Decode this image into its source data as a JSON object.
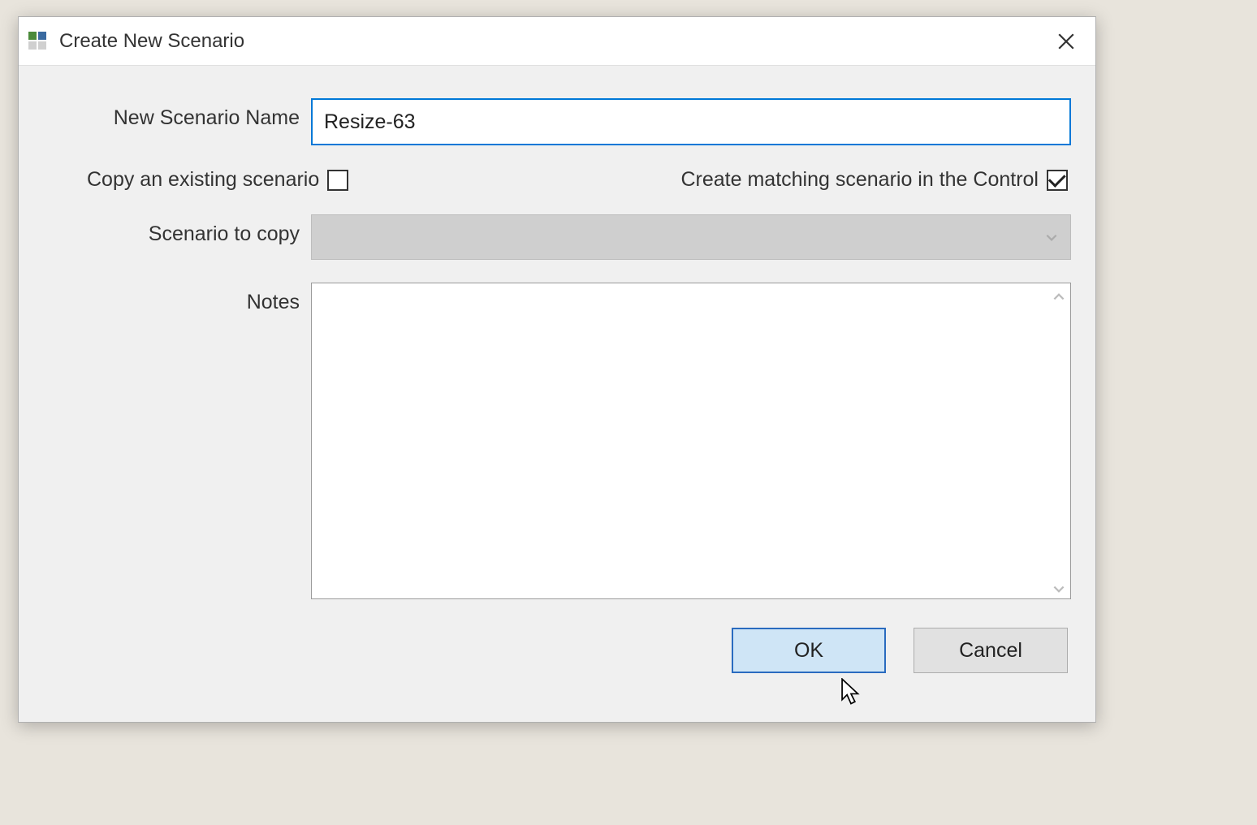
{
  "dialog": {
    "title": "Create New Scenario",
    "labels": {
      "name": "New Scenario Name",
      "copy_existing": "Copy an existing scenario",
      "create_matching": "Create matching scenario in the Control",
      "scenario_to_copy": "Scenario to copy",
      "notes": "Notes"
    },
    "values": {
      "name": "Resize-63",
      "copy_existing_checked": false,
      "create_matching_checked": true,
      "scenario_to_copy_selected": "",
      "notes": ""
    },
    "buttons": {
      "ok": "OK",
      "cancel": "Cancel"
    }
  }
}
